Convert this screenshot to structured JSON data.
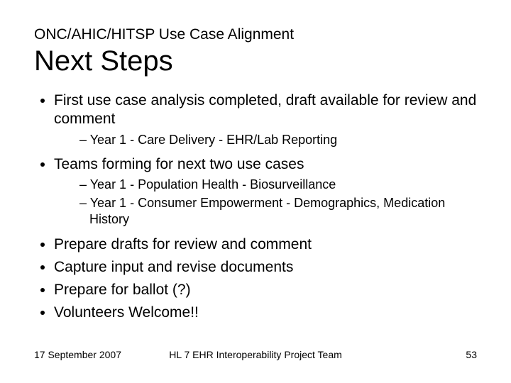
{
  "supertitle": "ONC/AHIC/HITSP Use Case Alignment",
  "title": "Next Steps",
  "bullets": {
    "b1": "First use case analysis completed, draft available for review and comment",
    "b1s1": "Year 1 - Care Delivery - EHR/Lab Reporting",
    "b2": "Teams forming for next two use cases",
    "b2s1": "Year 1 - Population Health - Biosurveillance",
    "b2s2": "Year 1 - Consumer Empowerment - Demographics, Medication History",
    "b3": "Prepare drafts for review and comment",
    "b4": "Capture input and revise documents",
    "b5": "Prepare for ballot (?)",
    "b6": "Volunteers Welcome!!"
  },
  "footer": {
    "date": "17 September 2007",
    "project": "HL 7 EHR Interoperability Project Team",
    "page": "53"
  }
}
